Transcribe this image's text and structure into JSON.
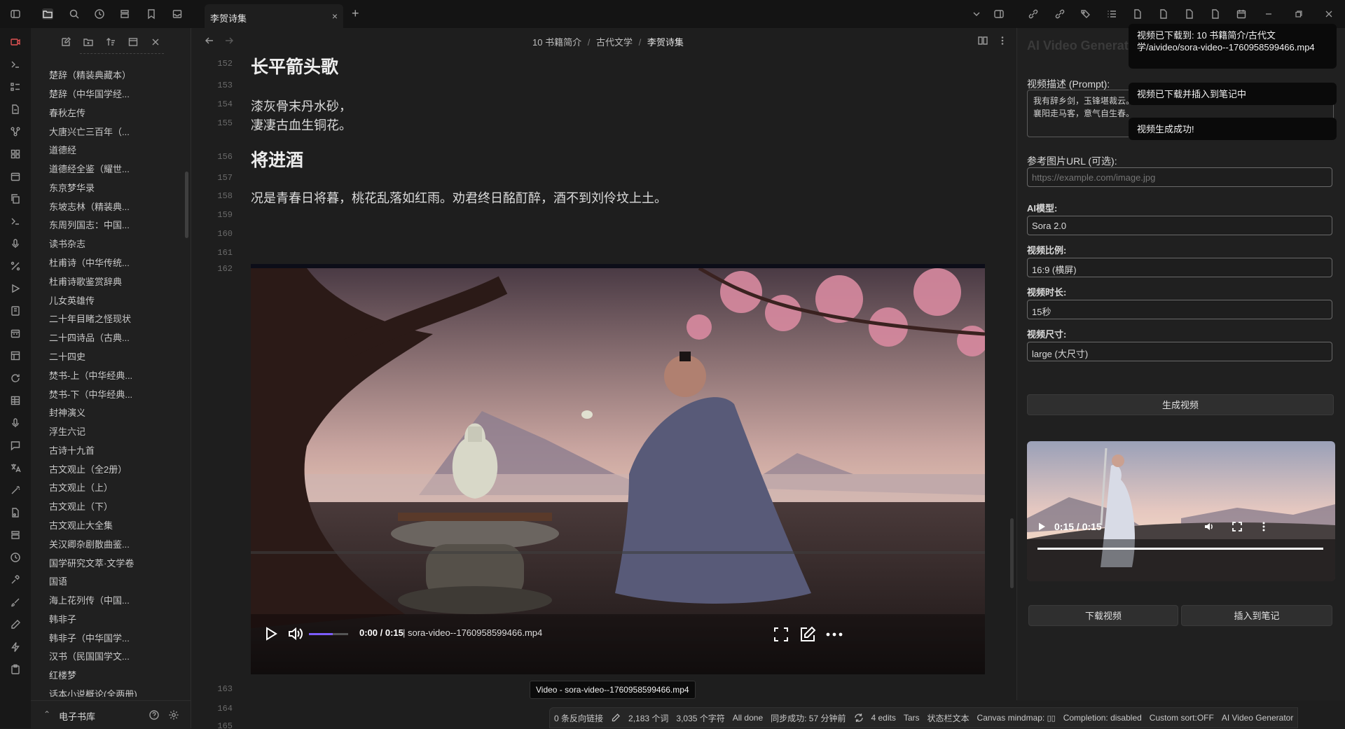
{
  "tab": {
    "title": "李贺诗集",
    "close": "×",
    "new": "+"
  },
  "breadcrumb": {
    "part1": "10 书籍简介",
    "sep": "/",
    "part2": "古代文学",
    "part3": "李贺诗集"
  },
  "sidebar": {
    "items": [
      "楚辞（精装典藏本）",
      "楚辞（中华国学经...",
      "春秋左传",
      "大唐兴亡三百年（...",
      "道德经",
      "道德经全鉴（耀世...",
      "东京梦华录",
      "东坡志林（精装典...",
      "东周列国志：中国...",
      "读书杂志",
      "杜甫诗（中华传统...",
      "杜甫诗歌鉴赏辞典",
      "儿女英雄传",
      "二十年目睹之怪现状",
      "二十四诗品（古典...",
      "二十四史",
      "焚书-上（中华经典...",
      "焚书-下（中华经典...",
      "封神演义",
      "浮生六记",
      "古诗十九首",
      "古文观止（全2册）",
      "古文观止（上）",
      "古文观止（下）",
      "古文观止大全集",
      "关汉卿杂剧散曲鉴...",
      "国学研究文萃·文学卷",
      "国语",
      "海上花列传（中国...",
      "韩非子",
      "韩非子（中华国学...",
      "汉书（民国国学文...",
      "红楼梦",
      "话本小说概论(全两册)"
    ],
    "vault_name": "电子书库"
  },
  "editor": {
    "line_numbers": [
      "152",
      "153",
      "154",
      "155",
      "156",
      "157",
      "158",
      "159",
      "160",
      "161",
      "162",
      "163",
      "164",
      "165"
    ],
    "heading1": "长平箭头歌",
    "poem_line1": "漆灰骨末丹水砂，",
    "poem_line2": "凄凄古血生铜花。",
    "heading2": "将进酒",
    "poem_line3": "况是青春日将暮，桃花乱落如红雨。劝君终日酩酊醉，酒不到刘伶坟上土。",
    "video": {
      "time": "0:00 / 0:15",
      "filename": "| sora-video--1760958599466.mp4",
      "volume_level": 0.6
    },
    "tooltip": "Video - sora-video--1760958599466.mp4"
  },
  "panel": {
    "title": "AI Video Generator",
    "prompt_label": "视频描述 (Prompt):",
    "prompt_value": "我有辞乡剑，玉锋堪裁云。\n襄阳走马客，意气自生春。",
    "image_url_label": "参考图片URL (可选):",
    "image_url_placeholder": "https://example.com/image.jpg",
    "model_label": "AI模型:",
    "model_value": "Sora 2.0",
    "ratio_label": "视频比例:",
    "ratio_value": "16:9 (横屏)",
    "duration_label": "视频时长:",
    "duration_value": "15秒",
    "size_label": "视频尺寸:",
    "size_value": "large (大尺寸)",
    "generate_button": "生成视频",
    "side_video": {
      "time": "0:15 / 0:15",
      "progress": 1.0
    },
    "download_button": "下载视频",
    "insert_button": "插入到笔记"
  },
  "notices": [
    "视频已下载到: 10 书籍简介/古代文学/aivideo/sora-video--1760958599466.mp4",
    "视频已下载并插入到笔记中",
    "视频生成成功!"
  ],
  "statusbar": {
    "backlinks": "0 条反向链接",
    "words": "2,183 个词",
    "chars": "3,035 个字符",
    "all_done": "All done",
    "sync": "同步成功: 57 分钟前",
    "edits": "4 edits",
    "tars": "Tars",
    "status_text": "状态栏文本",
    "canvas": "Canvas mindmap:",
    "completion": "Completion: disabled",
    "sort": "Custom sort:OFF",
    "ai": "AI Video Generator"
  },
  "colors": {
    "accent": "#7c5cff",
    "record": "#e05252",
    "background": "#1e1e1e"
  }
}
